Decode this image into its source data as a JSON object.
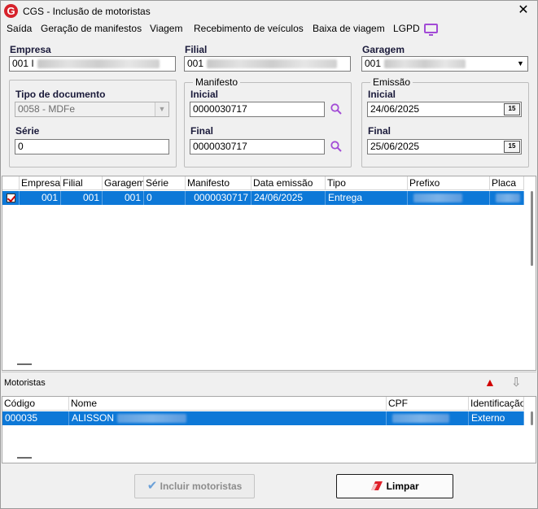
{
  "window": {
    "title": "CGS - Inclusão de motoristas",
    "logo_letter": "G",
    "close_glyph": "✕"
  },
  "menu": [
    "Saída",
    "Geração de manifestos",
    "Viagem",
    "Recebimento de veículos",
    "Baixa de viagem",
    "LGPD"
  ],
  "filters": {
    "empresa": {
      "label": "Empresa",
      "value": "001 I"
    },
    "filial": {
      "label": "Filial",
      "value": "001"
    },
    "garagem": {
      "label": "Garagem",
      "value": "001"
    },
    "tipo_documento": {
      "label": "Tipo de documento",
      "value": "0058 - MDFe"
    },
    "serie": {
      "label": "Série",
      "value": "0"
    },
    "manifesto": {
      "caption": "Manifesto",
      "inicial_label": "Inicial",
      "inicial_value": "0000030717",
      "final_label": "Final",
      "final_value": "0000030717"
    },
    "emissao": {
      "caption": "Emissão",
      "inicial_label": "Inicial",
      "inicial_value": "24/06/2025",
      "final_label": "Final",
      "final_value": "25/06/2025",
      "calendar_glyph": "15"
    }
  },
  "manifest_grid": {
    "columns": [
      "Empresa",
      "Filial",
      "Garagem",
      "Série",
      "Manifesto",
      "Data emissão",
      "Tipo",
      "Prefixo",
      "Placa"
    ],
    "rows": [
      {
        "checked": true,
        "empresa": "001",
        "filial": "001",
        "garagem": "001",
        "serie": "0",
        "manifesto": "0000030717",
        "data_emissao": "24/06/2025",
        "tipo": "Entrega"
      }
    ]
  },
  "motoristas": {
    "section_label": "Motoristas",
    "columns": [
      "Código",
      "Nome",
      "CPF",
      "Identificação"
    ],
    "rows": [
      {
        "codigo": "000035",
        "nome": "ALISSON",
        "identificacao": "Externo"
      }
    ]
  },
  "buttons": {
    "incluir": "Incluir motoristas",
    "limpar": "Limpar"
  },
  "icons": {
    "up_arrow": "▲",
    "down_arrow": "⇩",
    "dropdown": "▼",
    "check": "✔"
  },
  "colors": {
    "selection": "#0d78d7",
    "accent_search": "#a24bd6",
    "logo": "#d6222b"
  }
}
